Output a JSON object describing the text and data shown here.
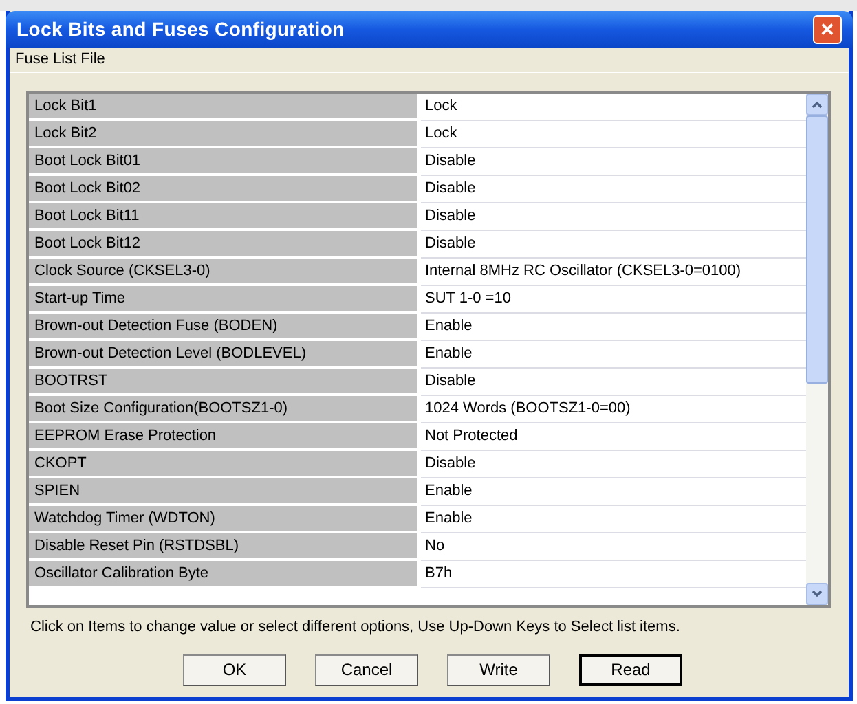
{
  "window": {
    "title": "Lock Bits and Fuses Configuration",
    "close": "✕"
  },
  "menu": [
    {
      "label": "Fuse List File"
    }
  ],
  "fuses": [
    {
      "name": "Lock Bit1",
      "value": "Lock"
    },
    {
      "name": "Lock Bit2",
      "value": "Lock"
    },
    {
      "name": "Boot Lock Bit01",
      "value": "Disable"
    },
    {
      "name": "Boot Lock Bit02",
      "value": "Disable"
    },
    {
      "name": "Boot Lock Bit11",
      "value": "Disable"
    },
    {
      "name": "Boot Lock Bit12",
      "value": "Disable"
    },
    {
      "name": "Clock Source (CKSEL3-0)",
      "value": "Internal 8MHz RC Oscillator (CKSEL3-0=0100)"
    },
    {
      "name": "Start-up Time",
      "value": "SUT 1-0 =10"
    },
    {
      "name": "Brown-out Detection Fuse (BODEN)",
      "value": "Enable"
    },
    {
      "name": "Brown-out Detection Level (BODLEVEL)",
      "value": "Enable"
    },
    {
      "name": "BOOTRST",
      "value": "Disable"
    },
    {
      "name": "Boot Size Configuration(BOOTSZ1-0)",
      "value": "1024 Words (BOOTSZ1-0=00)"
    },
    {
      "name": "EEPROM Erase Protection",
      "value": "Not Protected"
    },
    {
      "name": "CKOPT",
      "value": "Disable"
    },
    {
      "name": "SPIEN",
      "value": "Enable"
    },
    {
      "name": "Watchdog Timer (WDTON)",
      "value": "Enable"
    },
    {
      "name": "Disable Reset Pin  (RSTDSBL)",
      "value": "No"
    },
    {
      "name": "Oscillator Calibration Byte",
      "value": "B7h"
    }
  ],
  "hint": "Click on Items to change value or select different options, Use Up-Down Keys to Select list items.",
  "buttons": [
    {
      "label": "OK",
      "default": false
    },
    {
      "label": "Cancel",
      "default": false
    },
    {
      "label": "Write",
      "default": false
    },
    {
      "label": "Read",
      "default": true
    }
  ]
}
